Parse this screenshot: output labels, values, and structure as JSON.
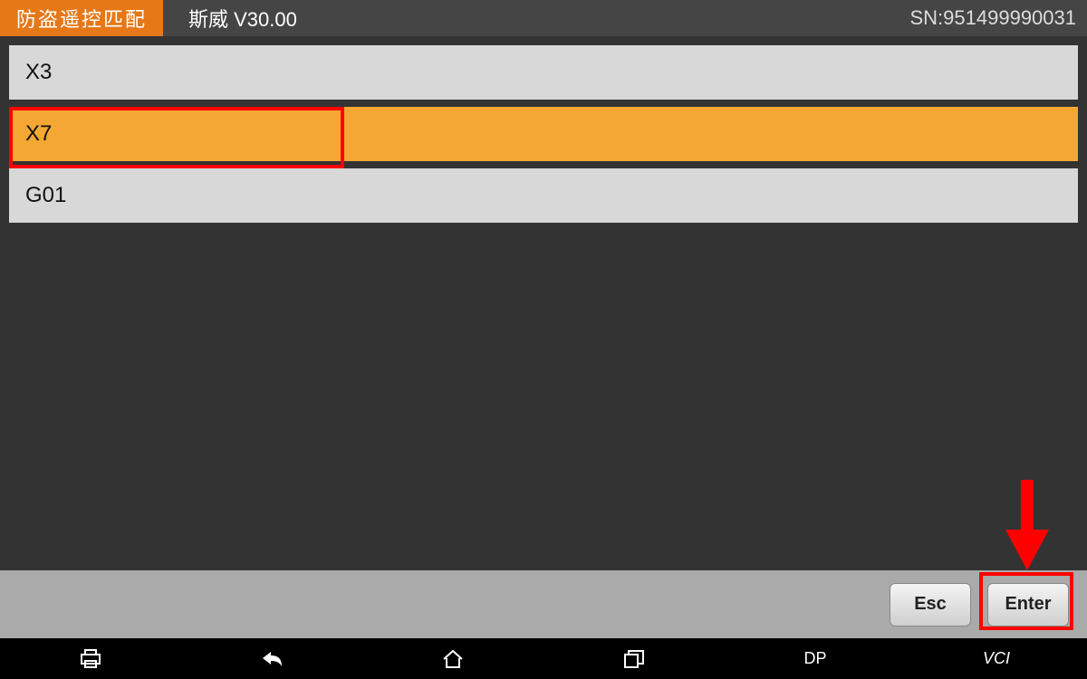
{
  "header": {
    "section_title": "防盗遥控匹配",
    "brand_version": "斯威  V30.00",
    "sn_label": "SN:951499990031"
  },
  "list": {
    "items": [
      {
        "label": "X3",
        "selected": false
      },
      {
        "label": "X7",
        "selected": true
      },
      {
        "label": "G01",
        "selected": false
      }
    ]
  },
  "footer_buttons": {
    "esc_label": "Esc",
    "enter_label": "Enter"
  },
  "navbar": {
    "dp_label": "DP",
    "vci_label": "VCI"
  }
}
